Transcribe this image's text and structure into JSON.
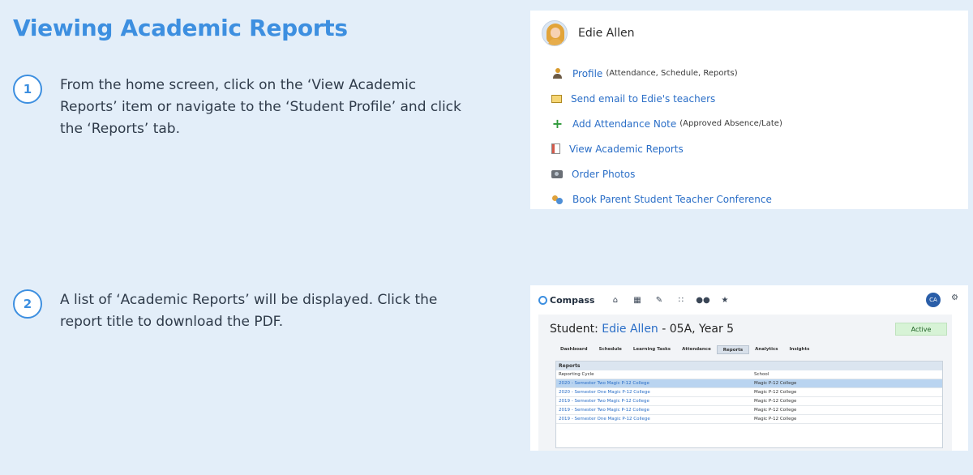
{
  "page": {
    "title": "Viewing Academic Reports"
  },
  "steps": [
    {
      "number": "1",
      "text": "From the home screen, click on the ‘View Academic Reports’ item or navigate to the ‘Student Profile’ and click the ‘Reports’ tab."
    },
    {
      "number": "2",
      "text": "A list of ‘Academic Reports’ will be displayed. Click the report title to download the PDF."
    }
  ],
  "home_card": {
    "student_name": "Edie Allen",
    "menu": [
      {
        "icon": "profile-icon",
        "label": "Profile",
        "note": "(Attendance, Schedule, Reports)"
      },
      {
        "icon": "email-icon",
        "label": "Send email to Edie's teachers",
        "note": ""
      },
      {
        "icon": "plus-icon",
        "label": "Add Attendance Note",
        "note": "(Approved Absence/Late)"
      },
      {
        "icon": "report-icon",
        "label": "View Academic Reports",
        "note": ""
      },
      {
        "icon": "camera-icon",
        "label": "Order Photos",
        "note": ""
      },
      {
        "icon": "conference-icon",
        "label": "Book Parent Student Teacher Conference",
        "note": ""
      }
    ]
  },
  "compass": {
    "brand": "Compass",
    "nav_icons": [
      "home-icon",
      "calendar-icon",
      "pencil-icon",
      "grid-icon",
      "people-icon",
      "star-icon"
    ],
    "user_initials": "CA",
    "student_prefix": "Student:",
    "student_name": "Edie Allen",
    "student_suffix": "- 05A, Year 5",
    "status": "Active",
    "tabs": [
      "Dashboard",
      "Schedule",
      "Learning Tasks",
      "Attendance",
      "Reports",
      "Analytics",
      "Insights"
    ],
    "active_tab": "Reports",
    "reports": {
      "header": "Reports",
      "columns": [
        "Reporting Cycle",
        "School"
      ],
      "rows": [
        {
          "cycle": "2020 - Semester Two Magic P-12 College",
          "school": "Magic P-12 College"
        },
        {
          "cycle": "2020 - Semester One Magic P-12 College",
          "school": "Magic P-12 College"
        },
        {
          "cycle": "2019 - Semester Two Magic P-12 College",
          "school": "Magic P-12 College"
        },
        {
          "cycle": "2019 - Semester Two Magic P-12 College",
          "school": "Magic P-12 College"
        },
        {
          "cycle": "2019 - Semester One Magic P-12 College",
          "school": "Magic P-12 College"
        }
      ]
    }
  }
}
